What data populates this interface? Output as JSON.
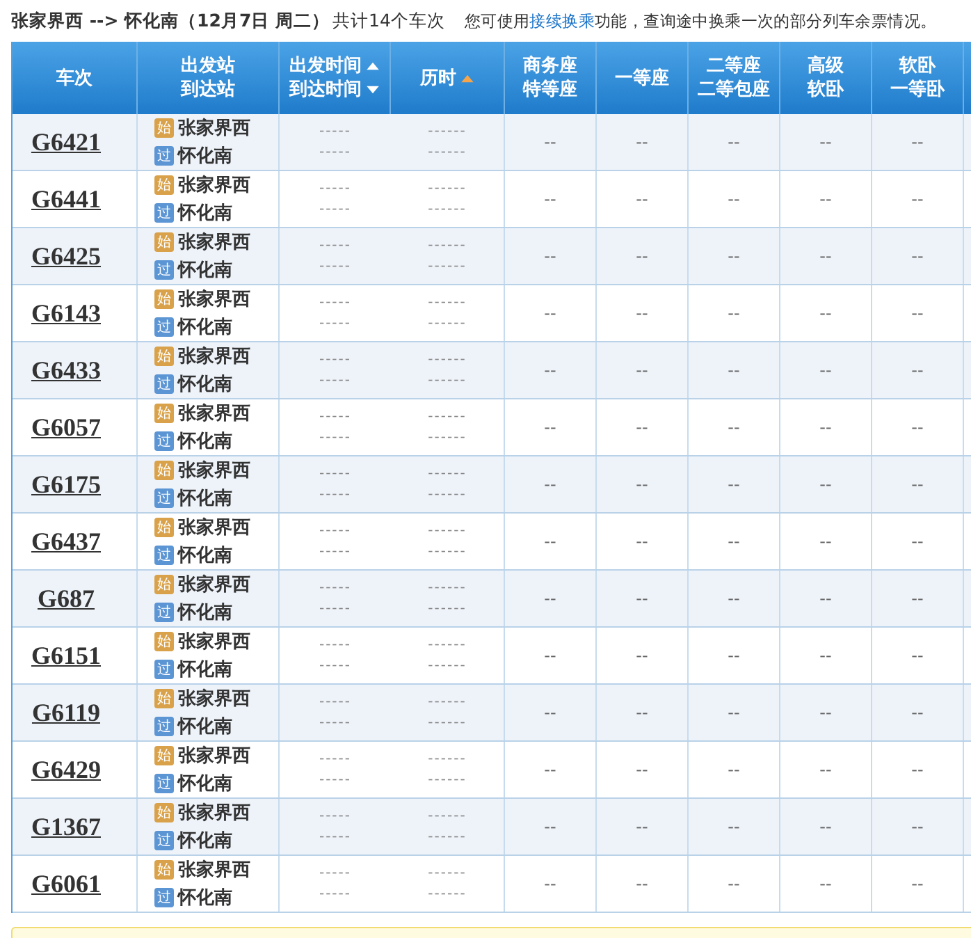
{
  "summary": {
    "route": "张家界西 --> 怀化南（12月7日  周二）",
    "count": "共计14个车次",
    "hint_before": "您可使用",
    "hint_link": "接续换乘",
    "hint_after": "功能，查询途中换乘一次的部分列车余票情况。"
  },
  "table": {
    "columns": [
      {
        "lines": [
          "车次"
        ],
        "sort_toggle": false,
        "sorted": false
      },
      {
        "lines": [
          "出发站",
          "到达站"
        ],
        "sort_toggle": false,
        "sorted": false
      },
      {
        "lines": [
          "出发时间",
          "到达时间"
        ],
        "sort_toggle": true,
        "sorted": false
      },
      {
        "lines": [
          "历时"
        ],
        "sort_toggle": false,
        "sorted": true
      },
      {
        "lines": [
          "商务座",
          "特等座"
        ],
        "sort_toggle": false,
        "sorted": false
      },
      {
        "lines": [
          "一等座"
        ],
        "sort_toggle": false,
        "sorted": false
      },
      {
        "lines": [
          "二等座",
          "二等包座"
        ],
        "sort_toggle": false,
        "sorted": false
      },
      {
        "lines": [
          "高级",
          "软卧"
        ],
        "sort_toggle": false,
        "sorted": false
      },
      {
        "lines": [
          "软卧",
          "一等卧"
        ],
        "sort_toggle": false,
        "sorted": false
      }
    ],
    "rows": [
      {
        "train": "G6421",
        "from_tag": "始",
        "from": "张家界西",
        "to_tag": "过",
        "to": "怀化南",
        "depart": "-----",
        "arrive": "-----",
        "duration_1": "------",
        "duration_2": "------",
        "seats": [
          "--",
          "--",
          "--",
          "--",
          "--"
        ]
      },
      {
        "train": "G6441",
        "from_tag": "始",
        "from": "张家界西",
        "to_tag": "过",
        "to": "怀化南",
        "depart": "-----",
        "arrive": "-----",
        "duration_1": "------",
        "duration_2": "------",
        "seats": [
          "--",
          "--",
          "--",
          "--",
          "--"
        ]
      },
      {
        "train": "G6425",
        "from_tag": "始",
        "from": "张家界西",
        "to_tag": "过",
        "to": "怀化南",
        "depart": "-----",
        "arrive": "-----",
        "duration_1": "------",
        "duration_2": "------",
        "seats": [
          "--",
          "--",
          "--",
          "--",
          "--"
        ]
      },
      {
        "train": "G6143",
        "from_tag": "始",
        "from": "张家界西",
        "to_tag": "过",
        "to": "怀化南",
        "depart": "-----",
        "arrive": "-----",
        "duration_1": "------",
        "duration_2": "------",
        "seats": [
          "--",
          "--",
          "--",
          "--",
          "--"
        ]
      },
      {
        "train": "G6433",
        "from_tag": "始",
        "from": "张家界西",
        "to_tag": "过",
        "to": "怀化南",
        "depart": "-----",
        "arrive": "-----",
        "duration_1": "------",
        "duration_2": "------",
        "seats": [
          "--",
          "--",
          "--",
          "--",
          "--"
        ]
      },
      {
        "train": "G6057",
        "from_tag": "始",
        "from": "张家界西",
        "to_tag": "过",
        "to": "怀化南",
        "depart": "-----",
        "arrive": "-----",
        "duration_1": "------",
        "duration_2": "------",
        "seats": [
          "--",
          "--",
          "--",
          "--",
          "--"
        ]
      },
      {
        "train": "G6175",
        "from_tag": "始",
        "from": "张家界西",
        "to_tag": "过",
        "to": "怀化南",
        "depart": "-----",
        "arrive": "-----",
        "duration_1": "------",
        "duration_2": "------",
        "seats": [
          "--",
          "--",
          "--",
          "--",
          "--"
        ]
      },
      {
        "train": "G6437",
        "from_tag": "始",
        "from": "张家界西",
        "to_tag": "过",
        "to": "怀化南",
        "depart": "-----",
        "arrive": "-----",
        "duration_1": "------",
        "duration_2": "------",
        "seats": [
          "--",
          "--",
          "--",
          "--",
          "--"
        ]
      },
      {
        "train": "G687",
        "from_tag": "始",
        "from": "张家界西",
        "to_tag": "过",
        "to": "怀化南",
        "depart": "-----",
        "arrive": "-----",
        "duration_1": "------",
        "duration_2": "------",
        "seats": [
          "--",
          "--",
          "--",
          "--",
          "--"
        ]
      },
      {
        "train": "G6151",
        "from_tag": "始",
        "from": "张家界西",
        "to_tag": "过",
        "to": "怀化南",
        "depart": "-----",
        "arrive": "-----",
        "duration_1": "------",
        "duration_2": "------",
        "seats": [
          "--",
          "--",
          "--",
          "--",
          "--"
        ]
      },
      {
        "train": "G6119",
        "from_tag": "始",
        "from": "张家界西",
        "to_tag": "过",
        "to": "怀化南",
        "depart": "-----",
        "arrive": "-----",
        "duration_1": "------",
        "duration_2": "------",
        "seats": [
          "--",
          "--",
          "--",
          "--",
          "--"
        ]
      },
      {
        "train": "G6429",
        "from_tag": "始",
        "from": "张家界西",
        "to_tag": "过",
        "to": "怀化南",
        "depart": "-----",
        "arrive": "-----",
        "duration_1": "------",
        "duration_2": "------",
        "seats": [
          "--",
          "--",
          "--",
          "--",
          "--"
        ]
      },
      {
        "train": "G1367",
        "from_tag": "始",
        "from": "张家界西",
        "to_tag": "过",
        "to": "怀化南",
        "depart": "-----",
        "arrive": "-----",
        "duration_1": "------",
        "duration_2": "------",
        "seats": [
          "--",
          "--",
          "--",
          "--",
          "--"
        ]
      },
      {
        "train": "G6061",
        "from_tag": "始",
        "from": "张家界西",
        "to_tag": "过",
        "to": "怀化南",
        "depart": "-----",
        "arrive": "-----",
        "duration_1": "------",
        "duration_2": "------",
        "seats": [
          "--",
          "--",
          "--",
          "--",
          "--"
        ]
      }
    ]
  }
}
